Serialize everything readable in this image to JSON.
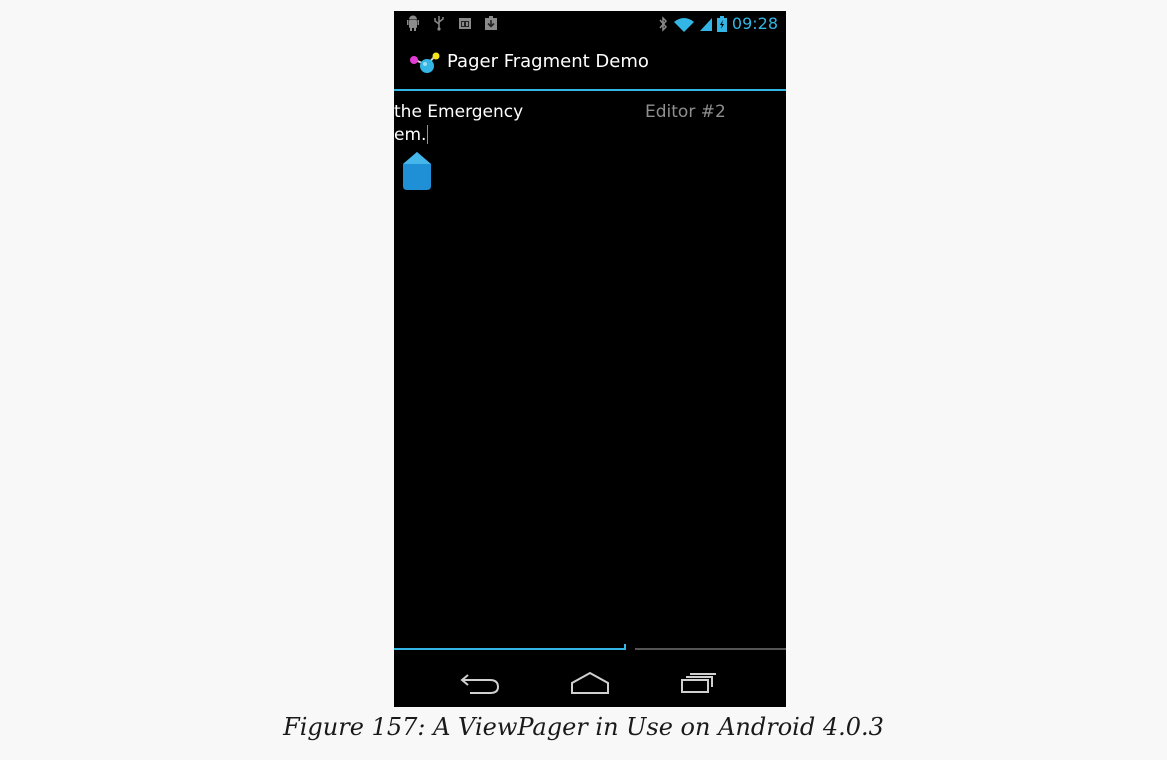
{
  "status_bar": {
    "time": "09:28",
    "left_icons": [
      "android-debug-icon",
      "usb-icon",
      "sd-card-icon",
      "download-icon"
    ],
    "right_icons": [
      "bluetooth-icon",
      "wifi-icon",
      "signal-icon",
      "battery-charging-icon"
    ],
    "accent_color": "#33b5e5"
  },
  "action_bar": {
    "app_icon": "app-logo-icon",
    "title": "Pager Fragment Demo"
  },
  "pager": {
    "editor1": {
      "line1": "the Emergency",
      "line2": "em."
    },
    "editor2": {
      "hint": "Editor #2"
    }
  },
  "nav_bar": {
    "back_icon": "back-icon",
    "home_icon": "home-icon",
    "recent_icon": "recent-apps-icon"
  },
  "caption": "Figure 157: A ViewPager in Use on Android 4.0.3"
}
